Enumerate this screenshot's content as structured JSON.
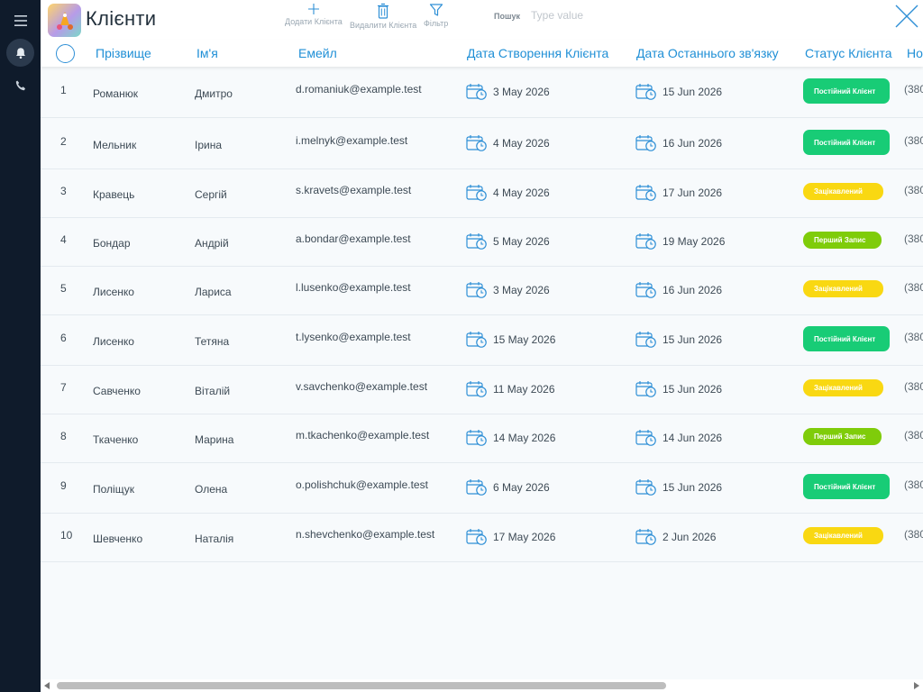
{
  "app": {
    "title": "Клієнти"
  },
  "toolbar": {
    "add_label": "Додати Клієнта",
    "delete_label": "Видалити Клієнта",
    "filter_label": "Фільтр",
    "search_label": "Пошук",
    "search_placeholder": "Type value"
  },
  "table": {
    "headers": {
      "last_name": "Прізвище",
      "first_name": "Ім'я",
      "email": "Емейл",
      "created": "Дата Створення Клієнта",
      "last_contact": "Дата Останнього зв'язку",
      "status": "Статус Клієнта",
      "phone": "Но"
    },
    "rows": [
      {
        "n": "1",
        "last": "Романюк",
        "first": "Дмитро",
        "email": "d.romaniuk@example.test",
        "created": "3 May 2026",
        "contact": "15 Jun 2026",
        "status": "Постійний Клієнт",
        "status_type": "green",
        "phone": "(380"
      },
      {
        "n": "2",
        "last": "Мельник",
        "first": "Ірина",
        "email": "i.melnyk@example.test",
        "created": "4 May 2026",
        "contact": "16 Jun 2026",
        "status": "Постійний Клієнт",
        "status_type": "green",
        "phone": "(380"
      },
      {
        "n": "3",
        "last": "Кравець",
        "first": "Сергій",
        "email": "s.kravets@example.test",
        "created": "4 May 2026",
        "contact": "17 Jun 2026",
        "status": "Зацікавлений",
        "status_type": "yellow",
        "phone": "(380"
      },
      {
        "n": "4",
        "last": "Бондар",
        "first": "Андрій",
        "email": "a.bondar@example.test",
        "created": "5 May 2026",
        "contact": "19 May 2026",
        "status": "Перший Запис",
        "status_type": "lime",
        "phone": "(380"
      },
      {
        "n": "5",
        "last": "Лисенко",
        "first": "Лариса",
        "email": "l.lusenko@example.test",
        "created": "3 May 2026",
        "contact": "16 Jun 2026",
        "status": "Зацікавлений",
        "status_type": "yellow",
        "phone": "(380"
      },
      {
        "n": "6",
        "last": "Лисенко",
        "first": "Тетяна",
        "email": "t.lysenko@example.test",
        "created": "15 May 2026",
        "contact": "15 Jun 2026",
        "status": "Постійний Клієнт",
        "status_type": "green",
        "phone": "(380"
      },
      {
        "n": "7",
        "last": "Савченко",
        "first": "Віталій",
        "email": "v.savchenko@example.test",
        "created": "11 May 2026",
        "contact": "15 Jun 2026",
        "status": "Зацікавлений",
        "status_type": "yellow",
        "phone": "(380"
      },
      {
        "n": "8",
        "last": "Ткаченко",
        "first": "Марина",
        "email": "m.tkachenko@example.test",
        "created": "14 May 2026",
        "contact": "14 Jun 2026",
        "status": "Перший Запис",
        "status_type": "lime",
        "phone": "(380"
      },
      {
        "n": "9",
        "last": "Поліщук",
        "first": "Олена",
        "email": "o.polishchuk@example.test",
        "created": "6 May 2026",
        "contact": "15 Jun 2026",
        "status": "Постійний Клієнт",
        "status_type": "green",
        "phone": "(380"
      },
      {
        "n": "10",
        "last": "Шевченко",
        "first": "Наталія",
        "email": "n.shevchenko@example.test",
        "created": "17 May 2026",
        "contact": "2 Jun 2026",
        "status": "Зацікавлений",
        "status_type": "yellow",
        "phone": "(380"
      }
    ]
  },
  "colors": {
    "accent": "#1f8fd6",
    "sidebar": "#0f1b2b",
    "status_green": "#18cc76",
    "status_yellow": "#f9d812",
    "status_lime": "#7fcc0a"
  },
  "icons": {
    "sidebar": [
      "menu-icon",
      "bell-icon",
      "phone-icon"
    ],
    "toolbar": [
      "plus-icon",
      "trash-icon",
      "filter-icon"
    ],
    "window": [
      "close-icon"
    ],
    "cells": [
      "calendar-clock-icon"
    ]
  }
}
